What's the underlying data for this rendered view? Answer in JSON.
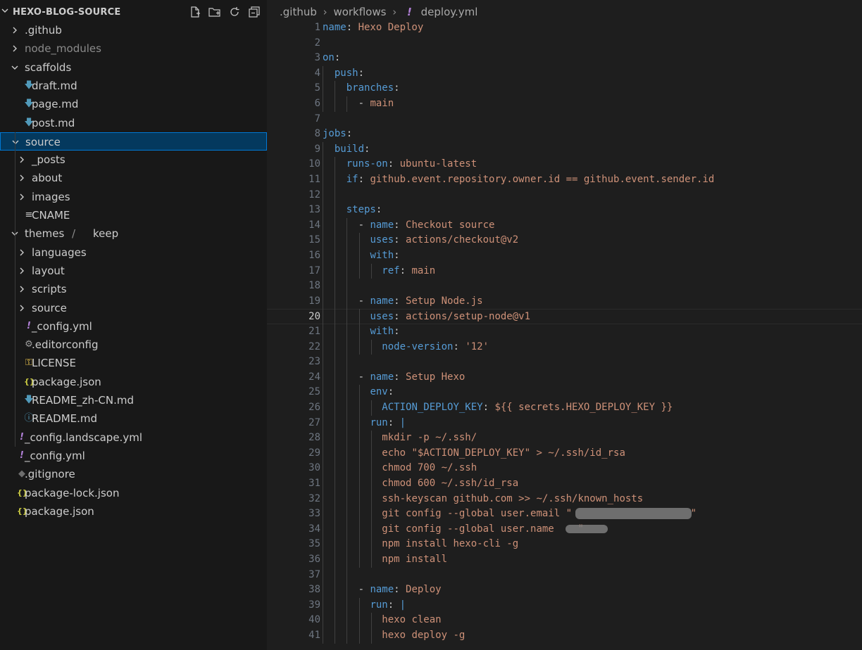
{
  "explorer": {
    "title": "HEXO-BLOG-SOURCE",
    "actions": [
      "new-file-icon",
      "new-folder-icon",
      "refresh-icon",
      "collapse-all-icon"
    ],
    "items": [
      {
        "label": ".github",
        "type": "folder",
        "expanded": false,
        "depth": 0
      },
      {
        "label": "node_modules",
        "type": "folder",
        "expanded": false,
        "depth": 0,
        "dim": true
      },
      {
        "label": "scaffolds",
        "type": "folder",
        "expanded": true,
        "depth": 0
      },
      {
        "label": "draft.md",
        "type": "file",
        "icon": "markdown-icon",
        "depth": 1
      },
      {
        "label": "page.md",
        "type": "file",
        "icon": "markdown-icon",
        "depth": 1
      },
      {
        "label": "post.md",
        "type": "file",
        "icon": "markdown-icon",
        "depth": 1
      },
      {
        "label": "source",
        "type": "folder",
        "expanded": true,
        "depth": 0,
        "selected": true
      },
      {
        "label": "_posts",
        "type": "folder",
        "expanded": false,
        "depth": 1
      },
      {
        "label": "about",
        "type": "folder",
        "expanded": false,
        "depth": 1
      },
      {
        "label": "images",
        "type": "folder",
        "expanded": false,
        "depth": 1
      },
      {
        "label": "CNAME",
        "type": "file",
        "icon": "text-lines-icon",
        "depth": 1
      },
      {
        "label": "themes",
        "label2": "keep",
        "type": "folder",
        "expanded": true,
        "depth": 0,
        "compact": true
      },
      {
        "label": "languages",
        "type": "folder",
        "expanded": false,
        "depth": 1
      },
      {
        "label": "layout",
        "type": "folder",
        "expanded": false,
        "depth": 1
      },
      {
        "label": "scripts",
        "type": "folder",
        "expanded": false,
        "depth": 1
      },
      {
        "label": "source",
        "type": "folder",
        "expanded": false,
        "depth": 1
      },
      {
        "label": "_config.yml",
        "type": "file",
        "icon": "yaml-exclamation-icon",
        "depth": 1
      },
      {
        "label": ".editorconfig",
        "type": "file",
        "icon": "gear-icon",
        "depth": 1
      },
      {
        "label": "LICENSE",
        "type": "file",
        "icon": "license-icon",
        "depth": 1
      },
      {
        "label": "package.json",
        "type": "file",
        "icon": "json-braces-icon",
        "depth": 1
      },
      {
        "label": "README_zh-CN.md",
        "type": "file",
        "icon": "markdown-icon",
        "depth": 1
      },
      {
        "label": "README.md",
        "type": "file",
        "icon": "info-icon",
        "depth": 1
      },
      {
        "label": "_config.landscape.yml",
        "type": "file",
        "icon": "yaml-exclamation-icon",
        "depth": 0
      },
      {
        "label": "_config.yml",
        "type": "file",
        "icon": "yaml-exclamation-icon",
        "depth": 0
      },
      {
        "label": ".gitignore",
        "type": "file",
        "icon": "git-icon",
        "depth": 0
      },
      {
        "label": "package-lock.json",
        "type": "file",
        "icon": "json-braces-icon",
        "depth": 0
      },
      {
        "label": "package.json",
        "type": "file",
        "icon": "json-braces-icon",
        "depth": 0
      }
    ]
  },
  "editor": {
    "breadcrumb": [
      ".github",
      "workflows",
      "deploy.yml"
    ],
    "current_line": 20,
    "lines": [
      [
        [
          "k",
          "name"
        ],
        [
          "p",
          ": "
        ],
        [
          "s",
          "Hexo Deploy"
        ]
      ],
      [],
      [
        [
          "k",
          "on"
        ],
        [
          "p",
          ":"
        ]
      ],
      [
        [
          "p",
          "  "
        ],
        [
          "k",
          "push"
        ],
        [
          "p",
          ":"
        ]
      ],
      [
        [
          "p",
          "    "
        ],
        [
          "k",
          "branches"
        ],
        [
          "p",
          ":"
        ]
      ],
      [
        [
          "p",
          "      - "
        ],
        [
          "s",
          "main"
        ]
      ],
      [],
      [
        [
          "k",
          "jobs"
        ],
        [
          "p",
          ":"
        ]
      ],
      [
        [
          "p",
          "  "
        ],
        [
          "k",
          "build"
        ],
        [
          "p",
          ":"
        ]
      ],
      [
        [
          "p",
          "    "
        ],
        [
          "k",
          "runs-on"
        ],
        [
          "p",
          ": "
        ],
        [
          "s",
          "ubuntu-latest"
        ]
      ],
      [
        [
          "p",
          "    "
        ],
        [
          "k",
          "if"
        ],
        [
          "p",
          ": "
        ],
        [
          "s",
          "github.event.repository.owner.id == github.event.sender.id"
        ]
      ],
      [],
      [
        [
          "p",
          "    "
        ],
        [
          "k",
          "steps"
        ],
        [
          "p",
          ":"
        ]
      ],
      [
        [
          "p",
          "      - "
        ],
        [
          "k",
          "name"
        ],
        [
          "p",
          ": "
        ],
        [
          "s",
          "Checkout source"
        ]
      ],
      [
        [
          "p",
          "        "
        ],
        [
          "k",
          "uses"
        ],
        [
          "p",
          ": "
        ],
        [
          "s",
          "actions/checkout@v2"
        ]
      ],
      [
        [
          "p",
          "        "
        ],
        [
          "k",
          "with"
        ],
        [
          "p",
          ":"
        ]
      ],
      [
        [
          "p",
          "          "
        ],
        [
          "k",
          "ref"
        ],
        [
          "p",
          ": "
        ],
        [
          "s",
          "main"
        ]
      ],
      [],
      [
        [
          "p",
          "      - "
        ],
        [
          "k",
          "name"
        ],
        [
          "p",
          ": "
        ],
        [
          "s",
          "Setup Node.js"
        ]
      ],
      [
        [
          "p",
          "        "
        ],
        [
          "k",
          "uses"
        ],
        [
          "p",
          ": "
        ],
        [
          "s",
          "actions/setup-node@v1"
        ]
      ],
      [
        [
          "p",
          "        "
        ],
        [
          "k",
          "with"
        ],
        [
          "p",
          ":"
        ]
      ],
      [
        [
          "p",
          "          "
        ],
        [
          "k",
          "node-version"
        ],
        [
          "p",
          ": "
        ],
        [
          "s",
          "'12'"
        ]
      ],
      [],
      [
        [
          "p",
          "      - "
        ],
        [
          "k",
          "name"
        ],
        [
          "p",
          ": "
        ],
        [
          "s",
          "Setup Hexo"
        ]
      ],
      [
        [
          "p",
          "        "
        ],
        [
          "k",
          "env"
        ],
        [
          "p",
          ":"
        ]
      ],
      [
        [
          "p",
          "          "
        ],
        [
          "k",
          "ACTION_DEPLOY_KEY"
        ],
        [
          "p",
          ": "
        ],
        [
          "s",
          "${{ secrets.HEXO_DEPLOY_KEY }}"
        ]
      ],
      [
        [
          "p",
          "        "
        ],
        [
          "k",
          "run"
        ],
        [
          "p",
          ": "
        ],
        [
          "k",
          "|"
        ]
      ],
      [
        [
          "p",
          "          "
        ],
        [
          "s",
          "mkdir -p ~/.ssh/"
        ]
      ],
      [
        [
          "p",
          "          "
        ],
        [
          "s",
          "echo \"$ACTION_DEPLOY_KEY\" > ~/.ssh/id_rsa"
        ]
      ],
      [
        [
          "p",
          "          "
        ],
        [
          "s",
          "chmod 700 ~/.ssh"
        ]
      ],
      [
        [
          "p",
          "          "
        ],
        [
          "s",
          "chmod 600 ~/.ssh/id_rsa"
        ]
      ],
      [
        [
          "p",
          "          "
        ],
        [
          "s",
          "ssh-keyscan github.com >> ~/.ssh/known_hosts"
        ]
      ],
      [
        [
          "p",
          "          "
        ],
        [
          "s",
          "git config --global user.email \"                    \""
        ]
      ],
      [
        [
          "p",
          "          "
        ],
        [
          "s",
          "git config --global user.name    \""
        ]
      ],
      [
        [
          "p",
          "          "
        ],
        [
          "s",
          "npm install hexo-cli -g"
        ]
      ],
      [
        [
          "p",
          "          "
        ],
        [
          "s",
          "npm install"
        ]
      ],
      [],
      [
        [
          "p",
          "      - "
        ],
        [
          "k",
          "name"
        ],
        [
          "p",
          ": "
        ],
        [
          "s",
          "Deploy"
        ]
      ],
      [
        [
          "p",
          "        "
        ],
        [
          "k",
          "run"
        ],
        [
          "p",
          ": "
        ],
        [
          "k",
          "|"
        ]
      ],
      [
        [
          "p",
          "          "
        ],
        [
          "s",
          "hexo clean"
        ]
      ],
      [
        [
          "p",
          "          "
        ],
        [
          "s",
          "hexo deploy -g"
        ]
      ]
    ]
  }
}
